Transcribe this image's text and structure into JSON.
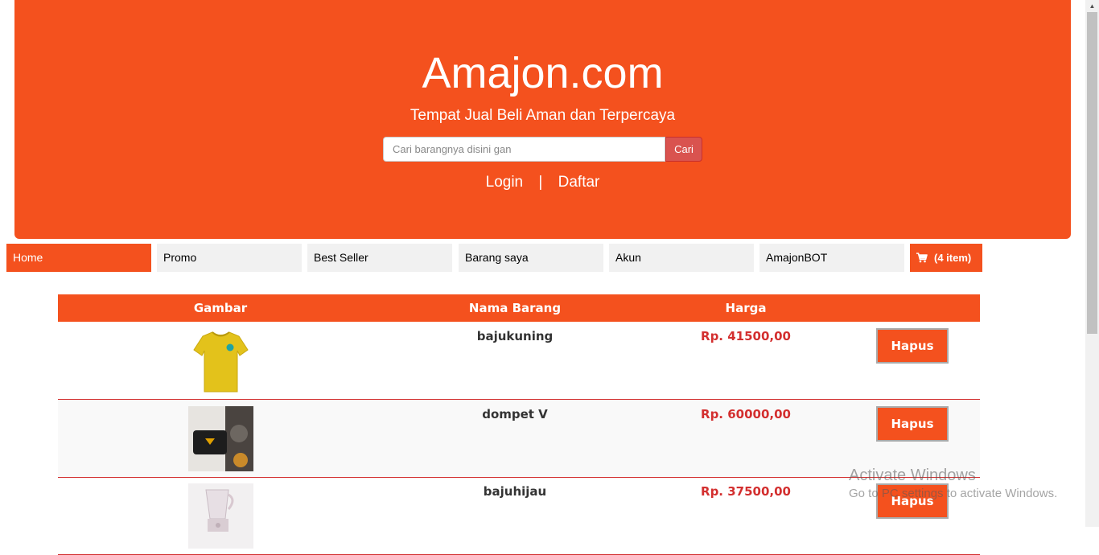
{
  "header": {
    "title": "Amajon.com",
    "subtitle": "Tempat Jual Beli Aman dan Terpercaya",
    "search_placeholder": "Cari barangnya disini gan",
    "search_button": "Cari",
    "login": "Login",
    "separator": "|",
    "register": "Daftar"
  },
  "nav": {
    "items": [
      {
        "label": "Home",
        "active": true
      },
      {
        "label": "Promo"
      },
      {
        "label": "Best Seller"
      },
      {
        "label": "Barang saya"
      },
      {
        "label": "Akun"
      },
      {
        "label": "AmajonBOT"
      }
    ],
    "cart_label": "(4 item)",
    "cart_icon": "cart-icon"
  },
  "table": {
    "headers": [
      "Gambar",
      "Nama Barang",
      "Harga"
    ],
    "rows": [
      {
        "image": "yellow-tshirt",
        "name": "bajukuning",
        "price": "Rp. 41500,00",
        "action": "Hapus"
      },
      {
        "image": "black-wallet",
        "name": "dompet V",
        "price": "Rp. 60000,00",
        "action": "Hapus"
      },
      {
        "image": "blender",
        "name": "bajuhijau",
        "price": "Rp. 37500,00",
        "action": "Hapus"
      }
    ]
  },
  "watermark": {
    "line1": "Activate Windows",
    "line2": "Go to PC settings to activate Windows."
  },
  "colors": {
    "brand": "#f4511e",
    "price": "#d32f2f",
    "search_button": "#d9534f"
  }
}
